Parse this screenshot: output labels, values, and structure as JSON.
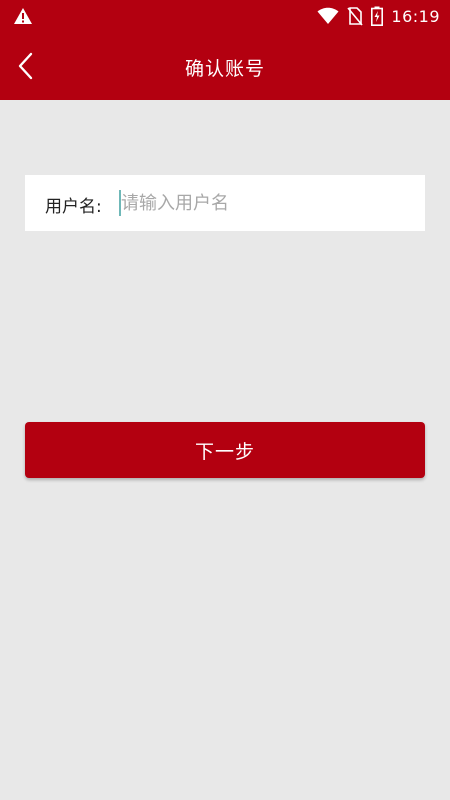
{
  "status_bar": {
    "time": "16:19",
    "icons": [
      "warning-icon",
      "wifi-icon",
      "no-sim-icon",
      "battery-charging-icon"
    ]
  },
  "app_bar": {
    "title": "确认账号",
    "back_icon": "chevron-left-icon"
  },
  "form": {
    "username_label": "用户名:",
    "username_placeholder": "请输入用户名",
    "username_value": ""
  },
  "actions": {
    "next_label": "下一步"
  },
  "colors": {
    "primary": "#b30010",
    "background": "#e8e8e8"
  }
}
